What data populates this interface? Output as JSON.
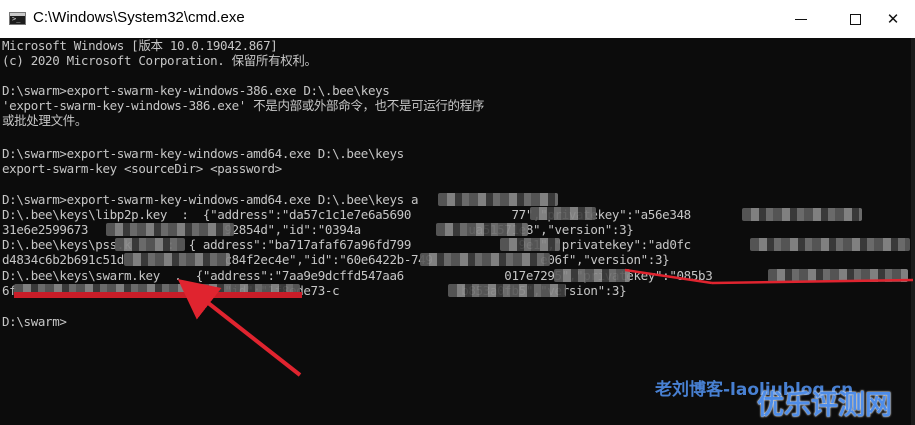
{
  "window": {
    "title": "C:\\Windows\\System32\\cmd.exe",
    "controls": {
      "minimize": "—",
      "maximize": "☐",
      "close": "✕"
    }
  },
  "console": {
    "lines": [
      "Microsoft Windows [版本 10.0.19042.867]",
      "(c) 2020 Microsoft Corporation. 保留所有权利。",
      "",
      "D:\\swarm>export-swarm-key-windows-386.exe D:\\.bee\\keys",
      "'export-swarm-key-windows-386.exe' 不是内部或外部命令，也不是可运行的程序",
      "或批处理文件。",
      "",
      "D:\\swarm>export-swarm-key-windows-amd64.exe D:\\.bee\\keys",
      "export-swarm-key <sourceDir> <password>",
      "",
      "D:\\swarm>export-swarm-key-windows-amd64.exe D:\\.bee\\keys a",
      "D:\\.bee\\keys\\libp2p.key  :  {\"address\":\"da57c1c1e7e6a5690              77\",\"privatekey\":\"a56e348",
      "31e6e2599673                   92854d\",\"id\":\"0394a               ua51571e8\",\"version\":3}",
      "D:\\.bee\\keys\\pss.k     :  { address\":\"ba717afaf67a96fd799               9e1\",\"privatekey\":\"ad0fc",
      "d4834c6b2b691c51d              c84f2ec4e\",\"id\":\"60e6422b-749               e06f\",\"version\":3}",
      "D:\\.bee\\keys\\swarm.key  .  {\"address\":\"7aa9e9dcffd547aa6              017e7295\",\"privatekey\":\"085b3",
      "6f                           \",\"id\":\"1f8ede73-c                 b853a0fb5\",\"version\":3}",
      "",
      "D:\\swarm>"
    ]
  },
  "watermark": {
    "small": "老刘博客-laoliublog.cn",
    "main": "优乐评测网"
  },
  "colors": {
    "console_bg": "#0c0c0c",
    "console_text": "#c6c6c6",
    "arrow_red": "#e0242f",
    "watermark_blue": "#4f8de8"
  }
}
